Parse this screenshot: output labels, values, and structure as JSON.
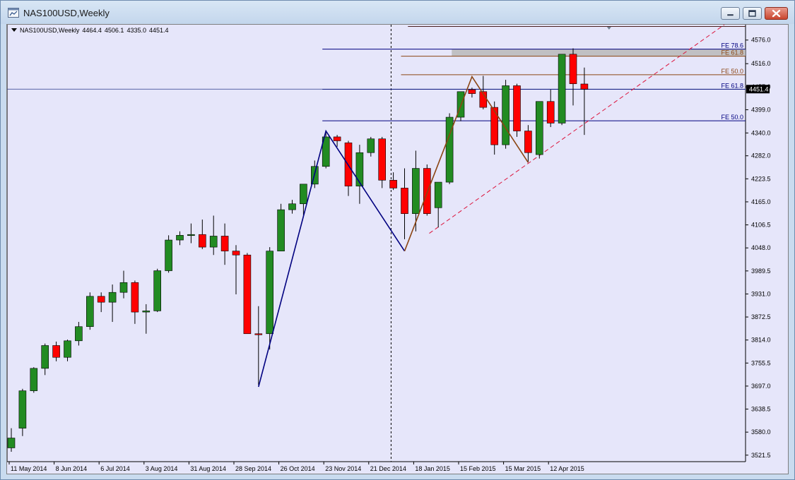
{
  "window": {
    "title": "NAS100USD,Weekly",
    "icon": "chart-window-icon",
    "controls": [
      "minimize-icon",
      "maximize-icon",
      "close-icon"
    ],
    "close_color": "#c9452f"
  },
  "header": {
    "symbol": "NAS100USD,Weekly",
    "open": "4464.4",
    "high": "4506.1",
    "low": "4335.0",
    "close": "4451.4"
  },
  "colors": {
    "background": "#e6e6fa",
    "bull": "#228b22",
    "bear": "#ff0000",
    "wick": "#000000",
    "fe_blue": "#000080",
    "fe_brown": "#8b4513",
    "trend_red": "#dc143c",
    "price_tag_bg": "#000000"
  },
  "chart_data": {
    "type": "candlestick",
    "symbol": "NAS100USD",
    "timeframe": "Weekly",
    "ylim": [
      3505,
      4615
    ],
    "y_ticks": [
      "4576.0",
      "4516.0",
      "4457.0",
      "4399.0",
      "4340.0",
      "4282.0",
      "4223.5",
      "4165.0",
      "4106.5",
      "4048.0",
      "3989.5",
      "3931.0",
      "3872.5",
      "3814.0",
      "3755.5",
      "3697.0",
      "3638.5",
      "3580.0",
      "3521.5"
    ],
    "x_ticks": [
      {
        "i": 0,
        "label": "11 May 2014"
      },
      {
        "i": 4,
        "label": "8 Jun 2014"
      },
      {
        "i": 8,
        "label": "6 Jul 2014"
      },
      {
        "i": 12,
        "label": "3 Aug 2014"
      },
      {
        "i": 16,
        "label": "31 Aug 2014"
      },
      {
        "i": 20,
        "label": "28 Sep 2014"
      },
      {
        "i": 24,
        "label": "26 Oct 2014"
      },
      {
        "i": 28,
        "label": "23 Nov 2014"
      },
      {
        "i": 32,
        "label": "21 Dec 2014"
      },
      {
        "i": 36,
        "label": "18 Jan 2015"
      },
      {
        "i": 40,
        "label": "15 Feb 2015"
      },
      {
        "i": 44,
        "label": "15 Mar 2015"
      },
      {
        "i": 48,
        "label": "12 Apr 2015"
      }
    ],
    "candles": [
      [
        3540,
        3590,
        3530,
        3565
      ],
      [
        3590,
        3690,
        3570,
        3685
      ],
      [
        3685,
        3745,
        3680,
        3742
      ],
      [
        3742,
        3805,
        3725,
        3800
      ],
      [
        3800,
        3810,
        3760,
        3770
      ],
      [
        3770,
        3815,
        3760,
        3812
      ],
      [
        3812,
        3860,
        3800,
        3848
      ],
      [
        3848,
        3935,
        3840,
        3925
      ],
      [
        3925,
        3935,
        3885,
        3910
      ],
      [
        3910,
        3955,
        3860,
        3935
      ],
      [
        3935,
        3990,
        3920,
        3960
      ],
      [
        3960,
        3965,
        3855,
        3885
      ],
      [
        3885,
        3905,
        3830,
        3888
      ],
      [
        3888,
        3995,
        3885,
        3990
      ],
      [
        3990,
        4080,
        3985,
        4068
      ],
      [
        4068,
        4090,
        4055,
        4080
      ],
      [
        4080,
        4110,
        4060,
        4082
      ],
      [
        4082,
        4120,
        4045,
        4050
      ],
      [
        4050,
        4130,
        4030,
        4078
      ],
      [
        4078,
        4110,
        4005,
        4040
      ],
      [
        4040,
        4055,
        3930,
        4030
      ],
      [
        4030,
        4035,
        3845,
        3830
      ],
      [
        3830,
        3900,
        3700,
        3828
      ],
      [
        3830,
        4050,
        3790,
        4040
      ],
      [
        4040,
        4160,
        4040,
        4145
      ],
      [
        4145,
        4170,
        4135,
        4160
      ],
      [
        4160,
        4190,
        4130,
        4210
      ],
      [
        4210,
        4270,
        4200,
        4255
      ],
      [
        4255,
        4345,
        4250,
        4330
      ],
      [
        4330,
        4335,
        4305,
        4320
      ],
      [
        4315,
        4320,
        4180,
        4205
      ],
      [
        4205,
        4310,
        4160,
        4290
      ],
      [
        4290,
        4330,
        4280,
        4325
      ],
      [
        4325,
        4330,
        4200,
        4220
      ],
      [
        4220,
        4240,
        4195,
        4200
      ],
      [
        4200,
        4250,
        4070,
        4135
      ],
      [
        4135,
        4295,
        4090,
        4250
      ],
      [
        4250,
        4260,
        4130,
        4135
      ],
      [
        4150,
        4210,
        4100,
        4215
      ],
      [
        4215,
        4390,
        4210,
        4380
      ],
      [
        4380,
        4445,
        4370,
        4445
      ],
      [
        4450,
        4455,
        4430,
        4440
      ],
      [
        4445,
        4485,
        4400,
        4405
      ],
      [
        4405,
        4420,
        4285,
        4310
      ],
      [
        4310,
        4475,
        4300,
        4460
      ],
      [
        4460,
        4465,
        4330,
        4345
      ],
      [
        4345,
        4360,
        4265,
        4290
      ],
      [
        4285,
        4420,
        4275,
        4420
      ],
      [
        4420,
        4450,
        4355,
        4365
      ],
      [
        4365,
        4540,
        4360,
        4540
      ],
      [
        4540,
        4555,
        4410,
        4465
      ],
      [
        4464.4,
        4506.1,
        4335.0,
        4451.4
      ]
    ],
    "last_price": "4451.4",
    "fib_levels": [
      {
        "label": "FE 78.6",
        "y": 4553,
        "color": "#000080",
        "x_from": 28
      },
      {
        "label": "FE 61.8",
        "y": 4535,
        "color": "#8b4513",
        "x_from": 35
      },
      {
        "label": "FE 50.0",
        "y": 4488,
        "color": "#8b4513",
        "x_from": 35
      },
      {
        "label": "FE 61.8",
        "y": 4451,
        "color": "#000080",
        "x_from": 28
      },
      {
        "label": "FE 50.0",
        "y": 4371,
        "color": "#000080",
        "x_from": 28
      }
    ],
    "zigzag_blue": [
      [
        22,
        3695
      ],
      [
        28,
        4345
      ],
      [
        35,
        4040
      ]
    ],
    "zigzag_brown": [
      [
        35,
        4040
      ],
      [
        41,
        4483
      ],
      [
        46,
        4265
      ]
    ]
  }
}
